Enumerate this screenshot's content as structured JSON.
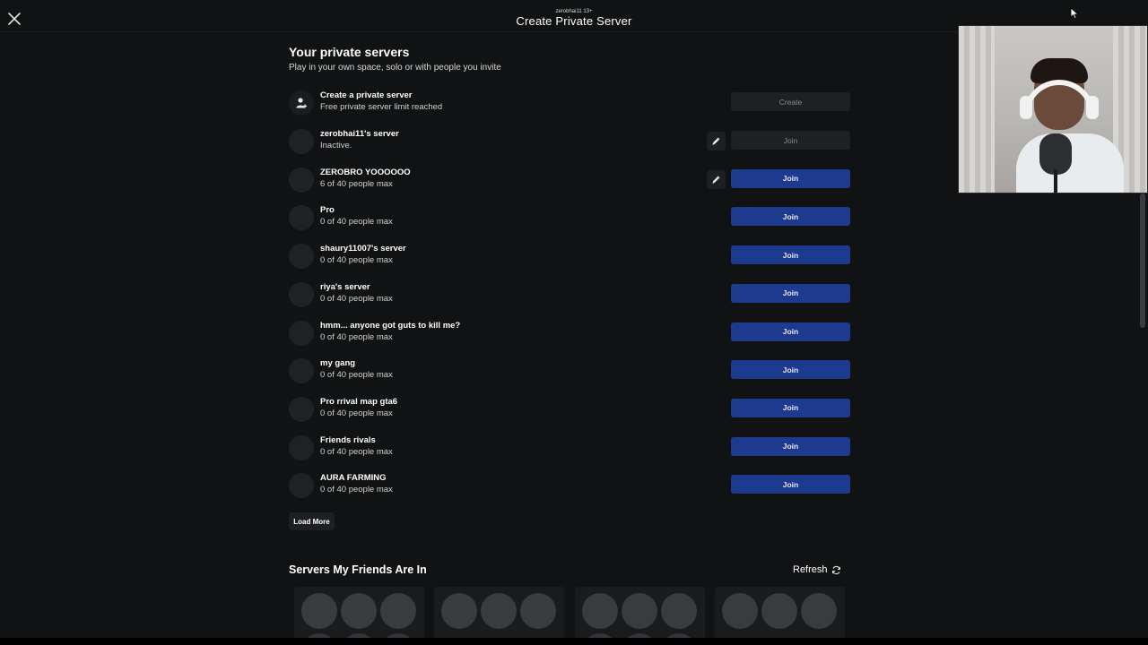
{
  "header": {
    "username": "zerobhai11 13+",
    "title": "Create Private Server"
  },
  "private_servers": {
    "title": "Your private servers",
    "subtitle": "Play in your own space, solo or with people you invite",
    "create_row": {
      "name": "Create a private server",
      "status": "Free private server limit reached",
      "button": "Create"
    },
    "servers": [
      {
        "name": "zerobhai11's server",
        "status": "Inactive.",
        "button": "Join",
        "editable": true,
        "active": false
      },
      {
        "name": "ZEROBRO YOOOOOO",
        "status": "6 of 40 people max",
        "button": "Join",
        "editable": true,
        "active": true
      },
      {
        "name": "Pro",
        "status": "0 of 40 people max",
        "button": "Join",
        "editable": false,
        "active": true
      },
      {
        "name": "shaury11007's server",
        "status": "0 of 40 people max",
        "button": "Join",
        "editable": false,
        "active": true
      },
      {
        "name": "riya's server",
        "status": "0 of 40 people max",
        "button": "Join",
        "editable": false,
        "active": true
      },
      {
        "name": "hmm... anyone got guts to kill me?",
        "status": "0 of 40 people max",
        "button": "Join",
        "editable": false,
        "active": true
      },
      {
        "name": "my gang",
        "status": "0 of 40 people max",
        "button": "Join",
        "editable": false,
        "active": true
      },
      {
        "name": "Pro rrival map gta6",
        "status": "0 of 40 people max",
        "button": "Join",
        "editable": false,
        "active": true
      },
      {
        "name": "Friends rivals",
        "status": "0 of 40 people max",
        "button": "Join",
        "editable": false,
        "active": true
      },
      {
        "name": "AURA FARMING",
        "status": "0 of 40 people max",
        "button": "Join",
        "editable": false,
        "active": true
      }
    ],
    "load_more": "Load More"
  },
  "friends_servers": {
    "title": "Servers My Friends Are In",
    "refresh": "Refresh",
    "card_count": 4
  },
  "colors": {
    "background": "#111213",
    "join_button": "#1e3a8f",
    "disabled_button": "#1f2022",
    "avatar_placeholder": "#1f2124"
  },
  "icons": {
    "close": "close-icon",
    "create": "person-add-icon",
    "edit": "pencil-icon",
    "refresh": "refresh-icon"
  }
}
